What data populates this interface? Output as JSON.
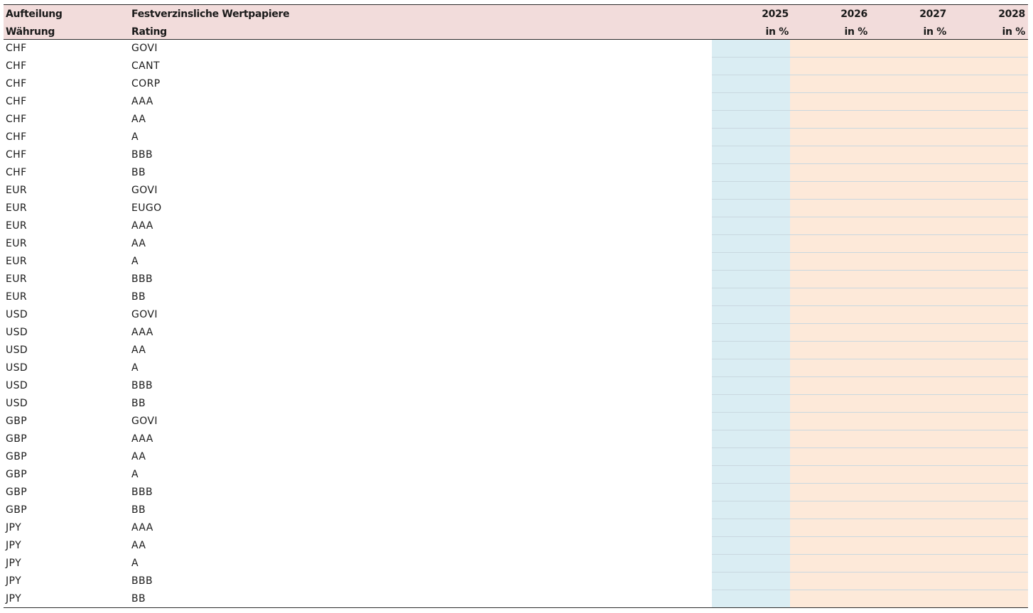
{
  "table": {
    "header_row1": {
      "col1": "Aufteilung",
      "col2": "Festverzinsliche Wertpapiere",
      "years": [
        "2025",
        "2026",
        "2027",
        "2028"
      ]
    },
    "header_row2": {
      "col1": "Währung",
      "col2": "Rating",
      "units": [
        "in %",
        "in %",
        "in %",
        "in %"
      ]
    },
    "rows": [
      {
        "currency": "CHF",
        "rating": "GOVI"
      },
      {
        "currency": "CHF",
        "rating": "CANT"
      },
      {
        "currency": "CHF",
        "rating": "CORP"
      },
      {
        "currency": "CHF",
        "rating": "AAA"
      },
      {
        "currency": "CHF",
        "rating": "AA"
      },
      {
        "currency": "CHF",
        "rating": "A"
      },
      {
        "currency": "CHF",
        "rating": "BBB"
      },
      {
        "currency": "CHF",
        "rating": "BB"
      },
      {
        "currency": "EUR",
        "rating": "GOVI"
      },
      {
        "currency": "EUR",
        "rating": "EUGO"
      },
      {
        "currency": "EUR",
        "rating": "AAA"
      },
      {
        "currency": "EUR",
        "rating": "AA"
      },
      {
        "currency": "EUR",
        "rating": "A"
      },
      {
        "currency": "EUR",
        "rating": "BBB"
      },
      {
        "currency": "EUR",
        "rating": "BB"
      },
      {
        "currency": "USD",
        "rating": "GOVI"
      },
      {
        "currency": "USD",
        "rating": "AAA"
      },
      {
        "currency": "USD",
        "rating": "AA"
      },
      {
        "currency": "USD",
        "rating": "A"
      },
      {
        "currency": "USD",
        "rating": "BBB"
      },
      {
        "currency": "USD",
        "rating": "BB"
      },
      {
        "currency": "GBP",
        "rating": "GOVI"
      },
      {
        "currency": "GBP",
        "rating": "AAA"
      },
      {
        "currency": "GBP",
        "rating": "AA"
      },
      {
        "currency": "GBP",
        "rating": "A"
      },
      {
        "currency": "GBP",
        "rating": "BBB"
      },
      {
        "currency": "GBP",
        "rating": "BB"
      },
      {
        "currency": "JPY",
        "rating": "AAA"
      },
      {
        "currency": "JPY",
        "rating": "AA"
      },
      {
        "currency": "JPY",
        "rating": "A"
      },
      {
        "currency": "JPY",
        "rating": "BBB"
      },
      {
        "currency": "JPY",
        "rating": "BB"
      }
    ]
  },
  "colors": {
    "header_background": "#f2dcdb",
    "input_column_2025": "#daedf3",
    "input_columns_2026_2028": "#fde9d9"
  }
}
